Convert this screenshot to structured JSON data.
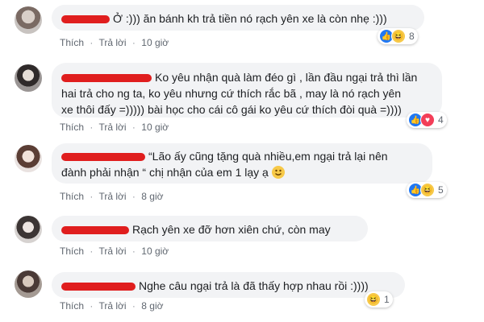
{
  "comments": [
    {
      "text": "Ở :))) ăn bánh kh trả tiền nó rạch yên xe là còn nhẹ :)))",
      "actions": {
        "like": "Thích",
        "reply": "Trả lời",
        "time": "10 giờ"
      },
      "reactions": {
        "icons": [
          "like-icon",
          "haha-icon"
        ],
        "count": "8"
      }
    },
    {
      "lines": [
        "Ko yêu nhận quà làm đéo gì , lần đầu ngại trả thì lần",
        "hai trả cho ng ta, ko yêu nhưng cứ thích rắc bã , may là nó rạch yên",
        "xe thôi đấy =))))) bài học cho cái cô gái ko yêu cứ thích đòi quà =))))"
      ],
      "actions": {
        "like": "Thích",
        "reply": "Trả lời",
        "time": "10 giờ"
      },
      "reactions": {
        "icons": [
          "like-icon",
          "love-icon"
        ],
        "count": "4"
      }
    },
    {
      "lines": [
        "“Lão ấy cũng tặng quà nhiều,em ngại trả lại nên",
        "đành phải nhận “ chị nhận của em 1 lạy ạ"
      ],
      "emoji": "smile-emoji",
      "actions": {
        "like": "Thích",
        "reply": "Trả lời",
        "time": "8 giờ"
      },
      "reactions": {
        "icons": [
          "like-icon",
          "haha-icon"
        ],
        "count": "5"
      }
    },
    {
      "text": "Rạch yên xe đỡ hơn xiên chứ, còn may",
      "actions": {
        "like": "Thích",
        "reply": "Trả lời",
        "time": "10 giờ"
      }
    },
    {
      "text": "Nghe câu ngại trả là đã thấy hợp nhau rồi :))))",
      "actions": {
        "like": "Thích",
        "reply": "Trả lời",
        "time": "8 giờ"
      },
      "reactions": {
        "icons": [
          "haha-icon"
        ],
        "count": "1"
      }
    }
  ],
  "separator": "·"
}
